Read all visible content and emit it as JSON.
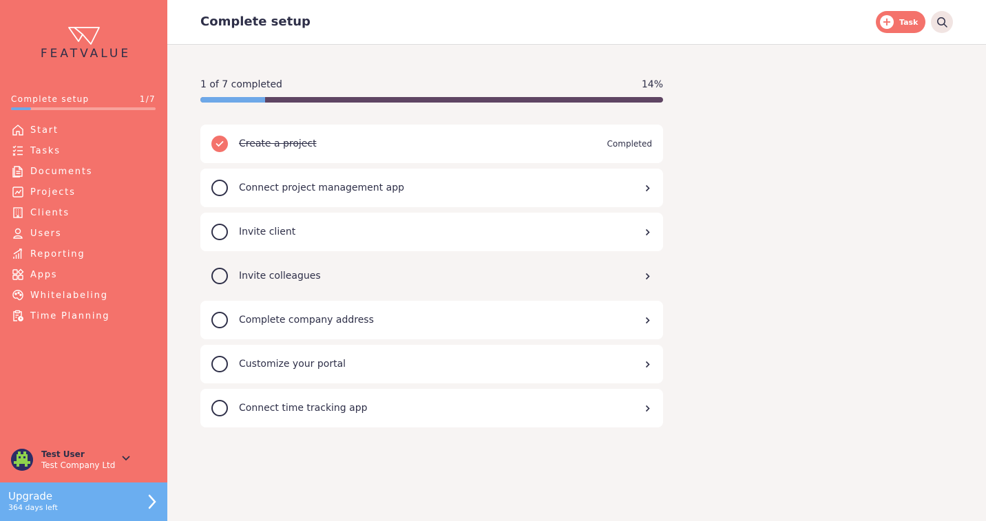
{
  "brand": {
    "name": "FEATVALUE",
    "color": "#f4726b"
  },
  "sidebar": {
    "setup": {
      "label": "Complete setup",
      "count": "1/7",
      "progress": 0.14
    },
    "items": [
      {
        "label": "Start",
        "icon": "home-icon"
      },
      {
        "label": "Tasks",
        "icon": "tasks-icon"
      },
      {
        "label": "Documents",
        "icon": "documents-icon"
      },
      {
        "label": "Projects",
        "icon": "projects-icon"
      },
      {
        "label": "Clients",
        "icon": "clients-icon"
      },
      {
        "label": "Users",
        "icon": "user-icon"
      },
      {
        "label": "Reporting",
        "icon": "reporting-icon"
      },
      {
        "label": "Apps",
        "icon": "apps-icon"
      },
      {
        "label": "Whitelabeling",
        "icon": "palette-icon"
      },
      {
        "label": "Time Planning",
        "icon": "clipboard-clock-icon"
      }
    ],
    "user": {
      "name": "Test User",
      "company": "Test Company Ltd"
    },
    "upgrade": {
      "title": "Upgrade",
      "subtitle": "364 days left"
    }
  },
  "header": {
    "title": "Complete setup",
    "task_button": "Task"
  },
  "progress": {
    "label": "1 of 7 completed",
    "percent_label": "14%",
    "value": 0.14
  },
  "checklist": [
    {
      "label": "Create a project",
      "status": "Completed",
      "done": true
    },
    {
      "label": "Connect project management app",
      "done": false
    },
    {
      "label": "Invite client",
      "done": false
    },
    {
      "label": "Invite colleagues",
      "done": false
    },
    {
      "label": "Complete company address",
      "done": false
    },
    {
      "label": "Customize your portal",
      "done": false
    },
    {
      "label": "Connect time tracking app",
      "done": false
    }
  ]
}
